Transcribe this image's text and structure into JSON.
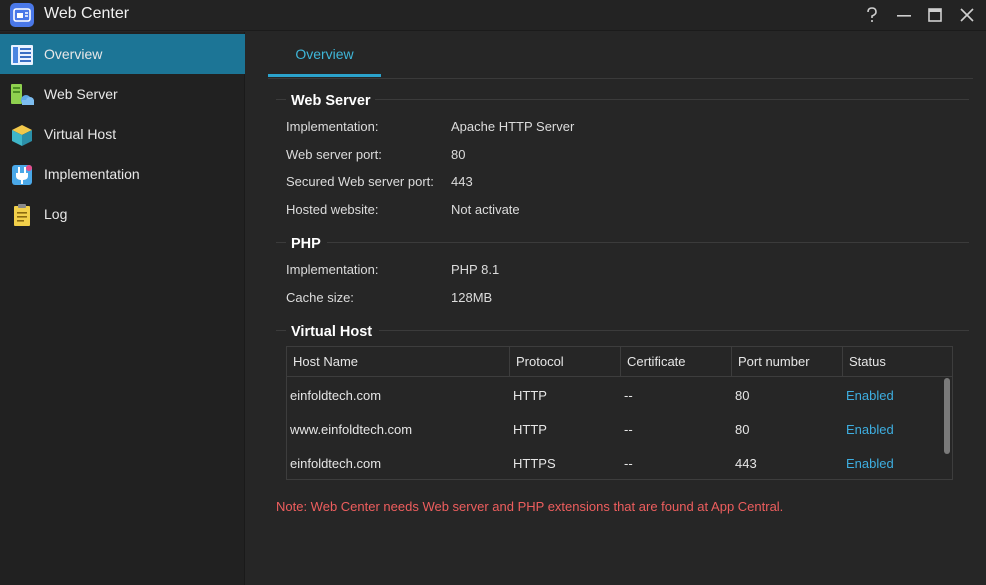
{
  "window": {
    "title": "Web Center",
    "controls": [
      "help-icon",
      "minimize-icon",
      "maximize-icon",
      "close-icon"
    ]
  },
  "sidebar": {
    "items": [
      {
        "label": "Overview",
        "icon": "overview-icon",
        "active": true
      },
      {
        "label": "Web Server",
        "icon": "web-server-icon",
        "active": false
      },
      {
        "label": "Virtual Host",
        "icon": "virtual-host-icon",
        "active": false
      },
      {
        "label": "Implementation",
        "icon": "implementation-icon",
        "active": false
      },
      {
        "label": "Log",
        "icon": "log-icon",
        "active": false
      }
    ]
  },
  "main": {
    "tabs": [
      {
        "label": "Overview",
        "active": true
      }
    ],
    "web_server": {
      "title": "Web Server",
      "rows": [
        {
          "label": "Implementation:",
          "value": "Apache HTTP Server"
        },
        {
          "label": "Web server port:",
          "value": "80"
        },
        {
          "label": "Secured Web server port:",
          "value": "443"
        },
        {
          "label": "Hosted website:",
          "value": "Not activate"
        }
      ]
    },
    "php": {
      "title": "PHP",
      "rows": [
        {
          "label": "Implementation:",
          "value": "PHP 8.1"
        },
        {
          "label": "Cache size:",
          "value": "128MB"
        }
      ]
    },
    "virtual_host": {
      "title": "Virtual Host",
      "columns": [
        "Host Name",
        "Protocol",
        "Certificate",
        "Port number",
        "Status"
      ],
      "rows": [
        {
          "host": "einfoldtech.com",
          "protocol": "HTTP",
          "certificate": "--",
          "port": "80",
          "status": "Enabled"
        },
        {
          "host": "www.einfoldtech.com",
          "protocol": "HTTP",
          "certificate": "--",
          "port": "80",
          "status": "Enabled"
        },
        {
          "host": "einfoldtech.com",
          "protocol": "HTTPS",
          "certificate": "--",
          "port": "443",
          "status": "Enabled"
        }
      ]
    },
    "note": "Note: Web Center needs Web server and PHP extensions that are found at App Central."
  },
  "colors": {
    "accent": "#1c7596",
    "tab_text": "#3fb6d8",
    "status_enabled": "#3eaee0",
    "note": "#ee5e5e"
  }
}
